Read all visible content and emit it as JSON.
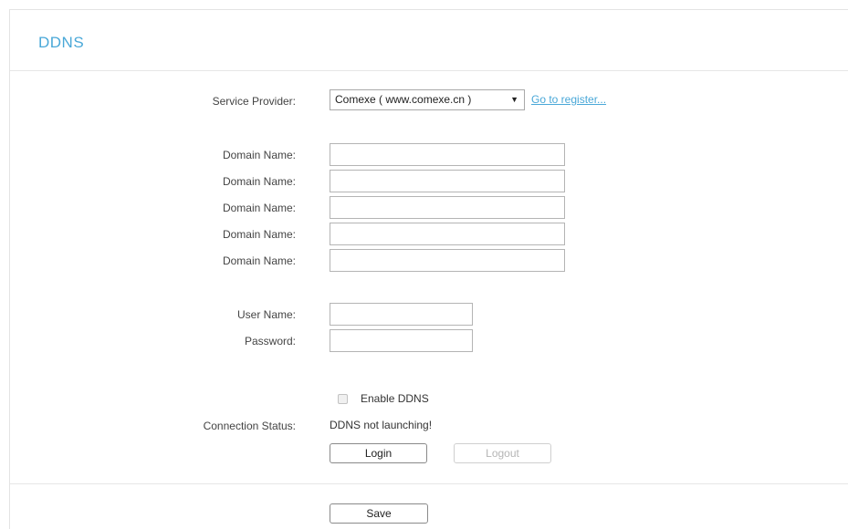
{
  "page": {
    "title": "DDNS"
  },
  "service_provider": {
    "label": "Service Provider:",
    "selected": "Comexe ( www.comexe.cn )",
    "register_link": "Go to register..."
  },
  "domains": [
    {
      "label": "Domain Name:",
      "value": ""
    },
    {
      "label": "Domain Name:",
      "value": ""
    },
    {
      "label": "Domain Name:",
      "value": ""
    },
    {
      "label": "Domain Name:",
      "value": ""
    },
    {
      "label": "Domain Name:",
      "value": ""
    }
  ],
  "account": {
    "username_label": "User Name:",
    "username_value": "",
    "password_label": "Password:",
    "password_value": ""
  },
  "enable": {
    "label": "Enable DDNS",
    "checked": false
  },
  "connection": {
    "label": "Connection Status:",
    "status": "DDNS not launching!"
  },
  "buttons": {
    "login": "Login",
    "logout": "Logout",
    "save": "Save"
  },
  "colors": {
    "accent": "#4aa8d8",
    "divider": "#e6e6e6",
    "disabled_text": "#b5b5b5"
  },
  "icons": {
    "dropdown_arrow": "triangle-down-icon",
    "checkbox": "checkbox-icon"
  }
}
